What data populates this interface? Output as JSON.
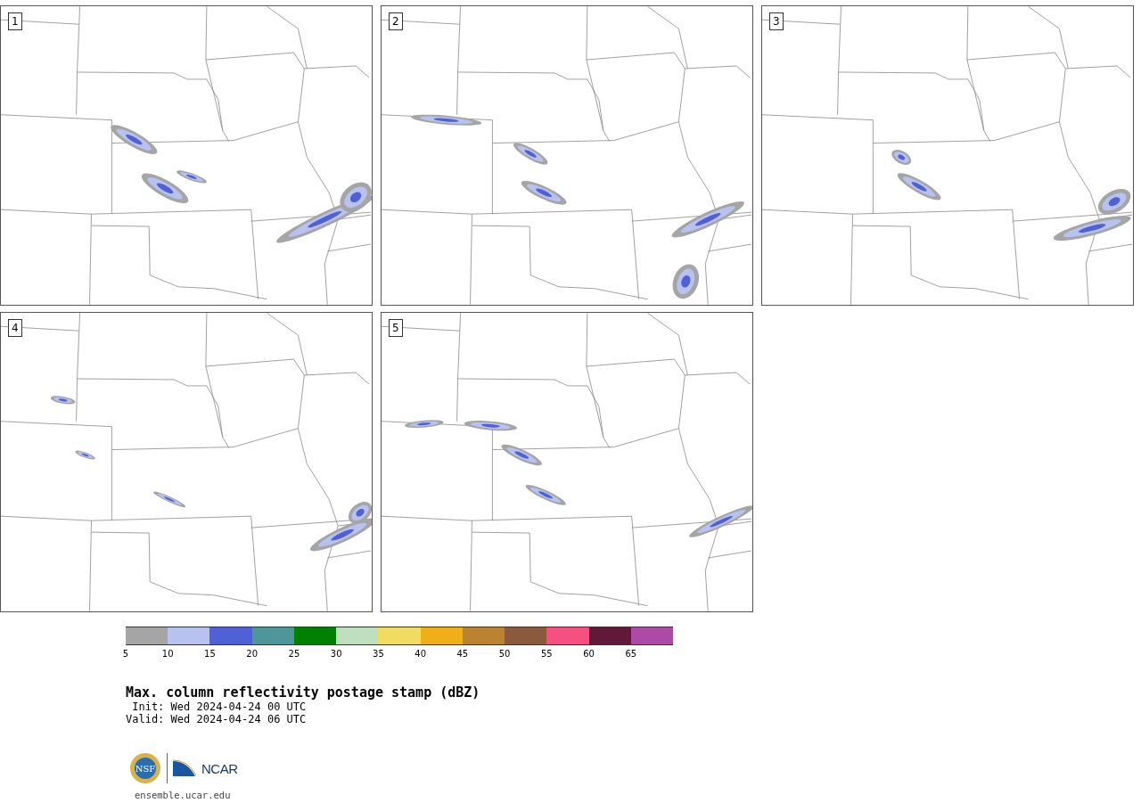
{
  "panels": [
    {
      "label": "1"
    },
    {
      "label": "2"
    },
    {
      "label": "3"
    },
    {
      "label": "4"
    },
    {
      "label": "5"
    }
  ],
  "colorbar": {
    "segments": [
      {
        "color": "#a5a5a5",
        "tick": "5"
      },
      {
        "color": "#b8c2ee",
        "tick": "10"
      },
      {
        "color": "#5060d6",
        "tick": "15"
      },
      {
        "color": "#4f969b",
        "tick": "20"
      },
      {
        "color": "#008000",
        "tick": "25"
      },
      {
        "color": "#bfdfbf",
        "tick": "30"
      },
      {
        "color": "#f0dc60",
        "tick": "35"
      },
      {
        "color": "#f0ae18",
        "tick": "40"
      },
      {
        "color": "#bb8230",
        "tick": "45"
      },
      {
        "color": "#8b5a3e",
        "tick": "50"
      },
      {
        "color": "#f55080",
        "tick": "55"
      },
      {
        "color": "#621838",
        "tick": "60"
      },
      {
        "color": "#ad4aa6",
        "tick": "65"
      }
    ]
  },
  "title": "Max. column reflectivity postage stamp (dBZ)",
  "init": " Init: Wed 2024-04-24 00 UTC",
  "valid": "Valid: Wed 2024-04-24 06 UTC",
  "logos": {
    "nsf": "NSF",
    "ncar": "NCAR"
  },
  "site": "ensemble.ucar.edu"
}
